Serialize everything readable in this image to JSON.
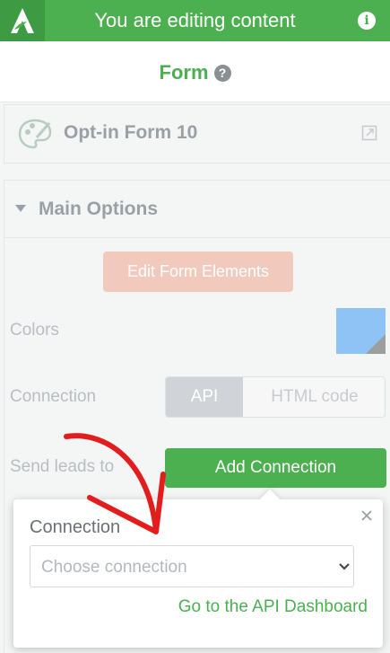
{
  "topbar": {
    "title": "You are editing content",
    "icons": {
      "logo": "thrive-logo",
      "info": "info-icon"
    }
  },
  "header": {
    "title": "Form",
    "help_icon": "help-icon"
  },
  "optin": {
    "name": "Opt-in Form 10",
    "icon": "palette-icon",
    "action_icon": "external-link-icon"
  },
  "main_options": {
    "title": "Main Options",
    "edit_button": "Edit Form Elements",
    "colors_label": "Colors",
    "swatch_color": "#90c3f5",
    "connection_label": "Connection",
    "connection_tabs": [
      "API",
      "HTML code"
    ],
    "connection_selected": "API",
    "send_leads_label": "Send leads to",
    "add_connection_button": "Add Connection"
  },
  "popup": {
    "title": "Connection",
    "select_placeholder": "Choose connection",
    "link": "Go to the API Dashboard"
  },
  "colors": {
    "accent": "#4caf50",
    "edit_button": "#f2c9bd",
    "annotation": "#e11d1d"
  }
}
